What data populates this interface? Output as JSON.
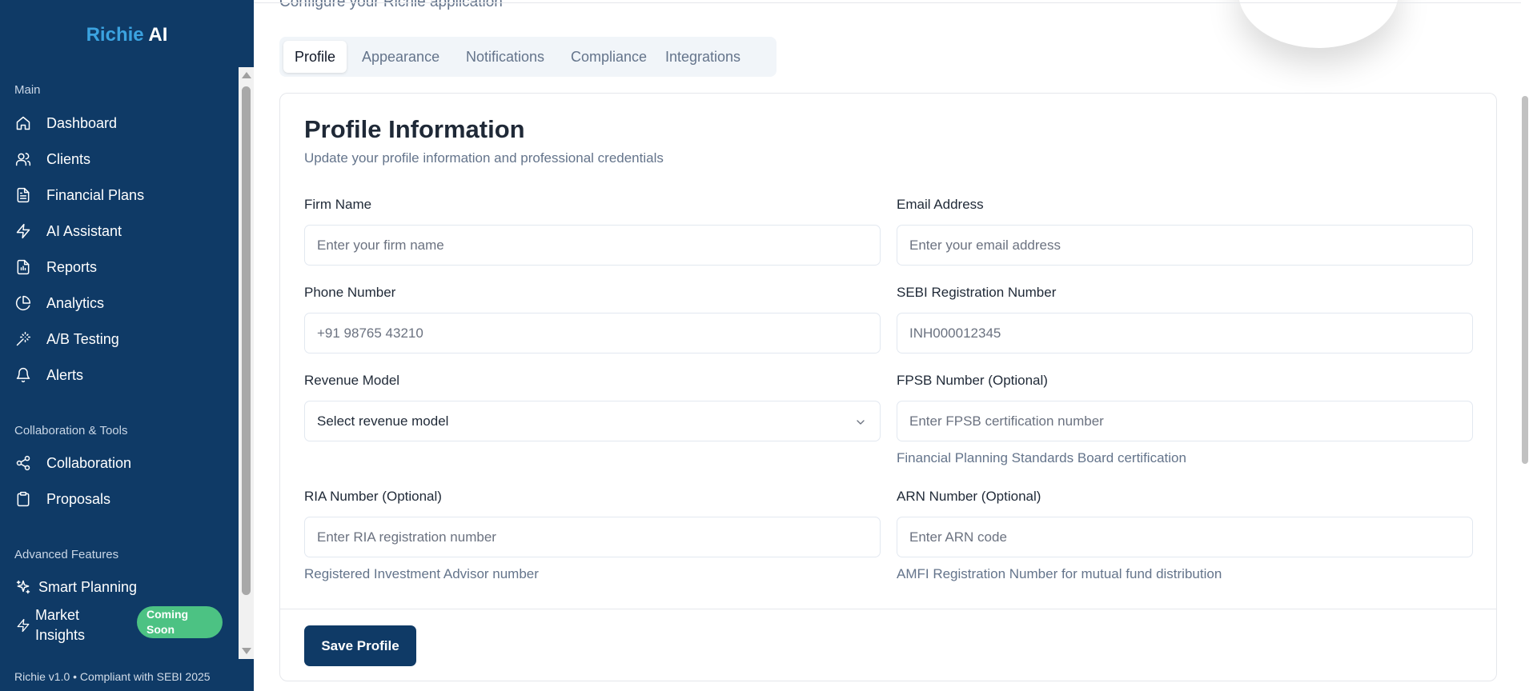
{
  "brand": {
    "part1": "Richie",
    "part2": "AI"
  },
  "sidebar": {
    "sections": [
      {
        "label": "Main"
      },
      {
        "label": "Collaboration & Tools"
      },
      {
        "label": "Advanced Features"
      }
    ],
    "items": [
      {
        "label": "Dashboard",
        "icon": "home-icon"
      },
      {
        "label": "Clients",
        "icon": "users-icon"
      },
      {
        "label": "Financial Plans",
        "icon": "file-text-icon"
      },
      {
        "label": "AI Assistant",
        "icon": "zap-icon"
      },
      {
        "label": "Reports",
        "icon": "file-chart-icon"
      },
      {
        "label": "Analytics",
        "icon": "pie-chart-icon"
      },
      {
        "label": "A/B Testing",
        "icon": "wand-icon"
      },
      {
        "label": "Alerts",
        "icon": "bell-icon"
      },
      {
        "label": "Collaboration",
        "icon": "share-icon"
      },
      {
        "label": "Proposals",
        "icon": "clipboard-icon"
      },
      {
        "label": "Smart Planning",
        "icon": "sparkles-icon"
      },
      {
        "label": "Market Insights",
        "icon": "zap-icon"
      }
    ],
    "badge": "Coming Soon",
    "footer": "Richie v1.0 • Compliant with SEBI 2025"
  },
  "header": {
    "subtitle": "Configure your Richie application"
  },
  "tabs": [
    {
      "label": "Profile",
      "active": true
    },
    {
      "label": "Appearance",
      "active": false
    },
    {
      "label": "Notifications",
      "active": false
    },
    {
      "label": "Compliance",
      "active": false
    },
    {
      "label": "Integrations",
      "active": false
    }
  ],
  "profile": {
    "title": "Profile Information",
    "description": "Update your profile information and professional credentials",
    "fields": {
      "firm_name": {
        "label": "Firm Name",
        "value": "",
        "placeholder": "Enter your firm name"
      },
      "email": {
        "label": "Email Address",
        "value": "",
        "placeholder": "Enter your email address"
      },
      "phone": {
        "label": "Phone Number",
        "value": "",
        "placeholder": "+91 98765 43210"
      },
      "sebi": {
        "label": "SEBI Registration Number",
        "value": "",
        "placeholder": "INH000012345"
      },
      "revenue_model": {
        "label": "Revenue Model",
        "value": "Select revenue model"
      },
      "fpsb": {
        "label": "FPSB Number (Optional)",
        "value": "",
        "placeholder": "Enter FPSB certification number",
        "help": "Financial Planning Standards Board certification"
      },
      "ria": {
        "label": "RIA Number (Optional)",
        "value": "",
        "placeholder": "Enter RIA registration number",
        "help": "Registered Investment Advisor number"
      },
      "arn": {
        "label": "ARN Number (Optional)",
        "value": "",
        "placeholder": "Enter ARN code",
        "help": "AMFI Registration Number for mutual fund distribution"
      }
    },
    "save_label": "Save Profile"
  },
  "colors": {
    "sidebar_bg": "#0f3a66",
    "brand_accent": "#3ba3e0",
    "badge_bg": "#4cc283",
    "primary_button": "#0f3a66"
  }
}
